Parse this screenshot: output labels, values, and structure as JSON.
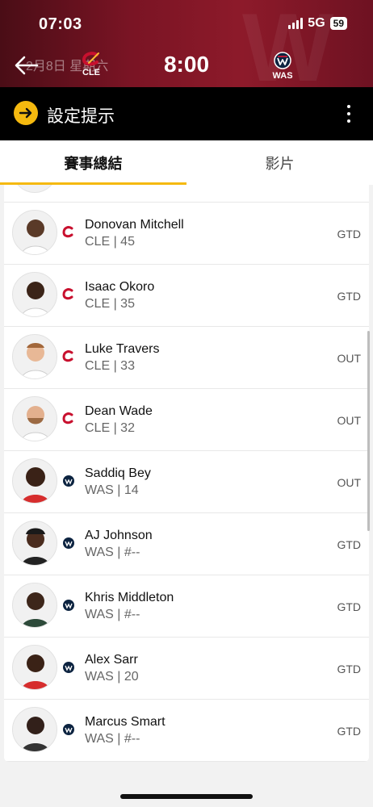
{
  "status_bar": {
    "time": "07:03",
    "network": "5G",
    "battery": "59"
  },
  "header": {
    "date_text": "2月8日 星期六",
    "game_time": "8:00",
    "home_team": {
      "abbr": "CLE"
    },
    "away_team": {
      "abbr": "WAS"
    },
    "colors": {
      "cle": "#8d1a2a",
      "was": "#0c2340",
      "accent": "#f5b90f"
    }
  },
  "alert_bar": {
    "label": "設定提示"
  },
  "tabs": [
    {
      "label": "賽事總結",
      "active": true
    },
    {
      "label": "影片",
      "active": false
    }
  ],
  "players": [
    {
      "name": "Donovan Mitchell",
      "sub": "CLE | 45",
      "status": "GTD",
      "team": "CLE"
    },
    {
      "name": "Isaac Okoro",
      "sub": "CLE | 35",
      "status": "GTD",
      "team": "CLE"
    },
    {
      "name": "Luke Travers",
      "sub": "CLE | 33",
      "status": "OUT",
      "team": "CLE"
    },
    {
      "name": "Dean Wade",
      "sub": "CLE | 32",
      "status": "OUT",
      "team": "CLE"
    },
    {
      "name": "Saddiq Bey",
      "sub": "WAS | 14",
      "status": "OUT",
      "team": "WAS"
    },
    {
      "name": "AJ Johnson",
      "sub": "WAS | #--",
      "status": "GTD",
      "team": "WAS"
    },
    {
      "name": "Khris Middleton",
      "sub": "WAS | #--",
      "status": "GTD",
      "team": "WAS"
    },
    {
      "name": "Alex Sarr",
      "sub": "WAS | 20",
      "status": "GTD",
      "team": "WAS"
    },
    {
      "name": "Marcus Smart",
      "sub": "WAS | #--",
      "status": "GTD",
      "team": "WAS"
    }
  ]
}
